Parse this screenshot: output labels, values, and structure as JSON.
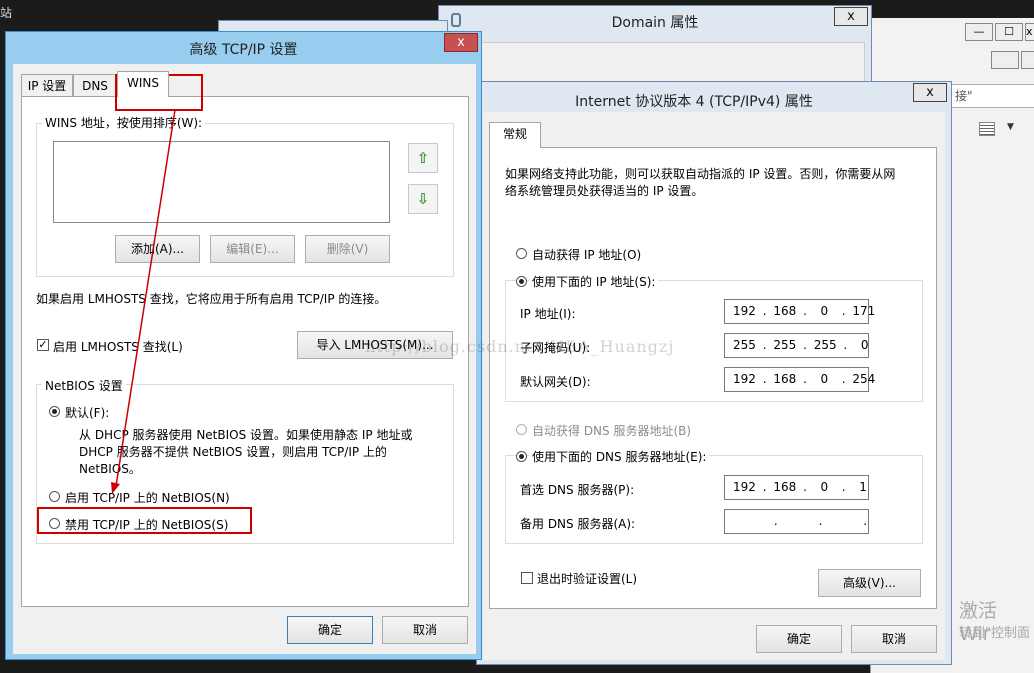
{
  "top_left_fragment": "站",
  "domain_window": {
    "title": "Domain 属性",
    "close": "x"
  },
  "bg_window": {
    "search_fragment": "接\"",
    "min": "—",
    "max": "☐",
    "close": "x"
  },
  "watermark": "http://blog.csdn.net/HBA_Huangzj",
  "activation": {
    "line1": "激活 Wir",
    "line2": "转到\"控制面"
  },
  "adv": {
    "title": "高级 TCP/IP 设置",
    "close": "x",
    "tabs": [
      "IP 设置",
      "DNS",
      "WINS"
    ],
    "wins_group_title": "WINS 地址，按使用排序(W):",
    "btn_add": "添加(A)...",
    "btn_edit": "编辑(E)...",
    "btn_delete": "删除(V)",
    "lmhosts_note": "如果启用 LMHOSTS 查找，它将应用于所有启用 TCP/IP 的连接。",
    "lmhosts_check": "启用 LMHOSTS 查找(L)",
    "import_btn": "导入 LMHOSTS(M)...",
    "netbios_title": "NetBIOS 设置",
    "opt_default": "默认(F):",
    "default_desc_1": "从 DHCP 服务器使用 NetBIOS 设置。如果使用静态 IP 地址或",
    "default_desc_2": "DHCP 服务器不提供 NetBIOS 设置，则启用 TCP/IP 上的",
    "default_desc_3": "NetBIOS。",
    "opt_enable": "启用 TCP/IP 上的 NetBIOS(N)",
    "opt_disable": "禁用 TCP/IP 上的 NetBIOS(S)",
    "ok": "确定",
    "cancel": "取消"
  },
  "ipv4": {
    "title": "Internet 协议版本 4 (TCP/IPv4) 属性",
    "close": "x",
    "tab": "常规",
    "intro_1": "如果网络支持此功能，则可以获取自动指派的 IP 设置。否则，你需要从网",
    "intro_2": "络系统管理员处获得适当的 IP 设置。",
    "auto_ip": "自动获得 IP 地址(O)",
    "manual_ip": "使用下面的 IP 地址(S):",
    "ip_label": "IP 地址(I):",
    "ip_value": "192 . 168 .  0  . 171",
    "mask_label": "子网掩码(U):",
    "mask_value": "255 . 255 . 255 .  0",
    "gw_label": "默认网关(D):",
    "gw_value": "192 . 168 .  0  . 254",
    "auto_dns": "自动获得 DNS 服务器地址(B)",
    "manual_dns": "使用下面的 DNS 服务器地址(E):",
    "dns1_label": "首选 DNS 服务器(P):",
    "dns1_value": "192 . 168 .  0  .  1",
    "dns2_label": "备用 DNS 服务器(A):",
    "dns2_value": "      .      .      .",
    "validate": "退出时验证设置(L)",
    "advanced": "高级(V)...",
    "ok": "确定",
    "cancel": "取消"
  },
  "colors": {
    "highlight": "#cc0000",
    "adv_titlebar": "#99cdf0",
    "close_red": "#c75050"
  }
}
